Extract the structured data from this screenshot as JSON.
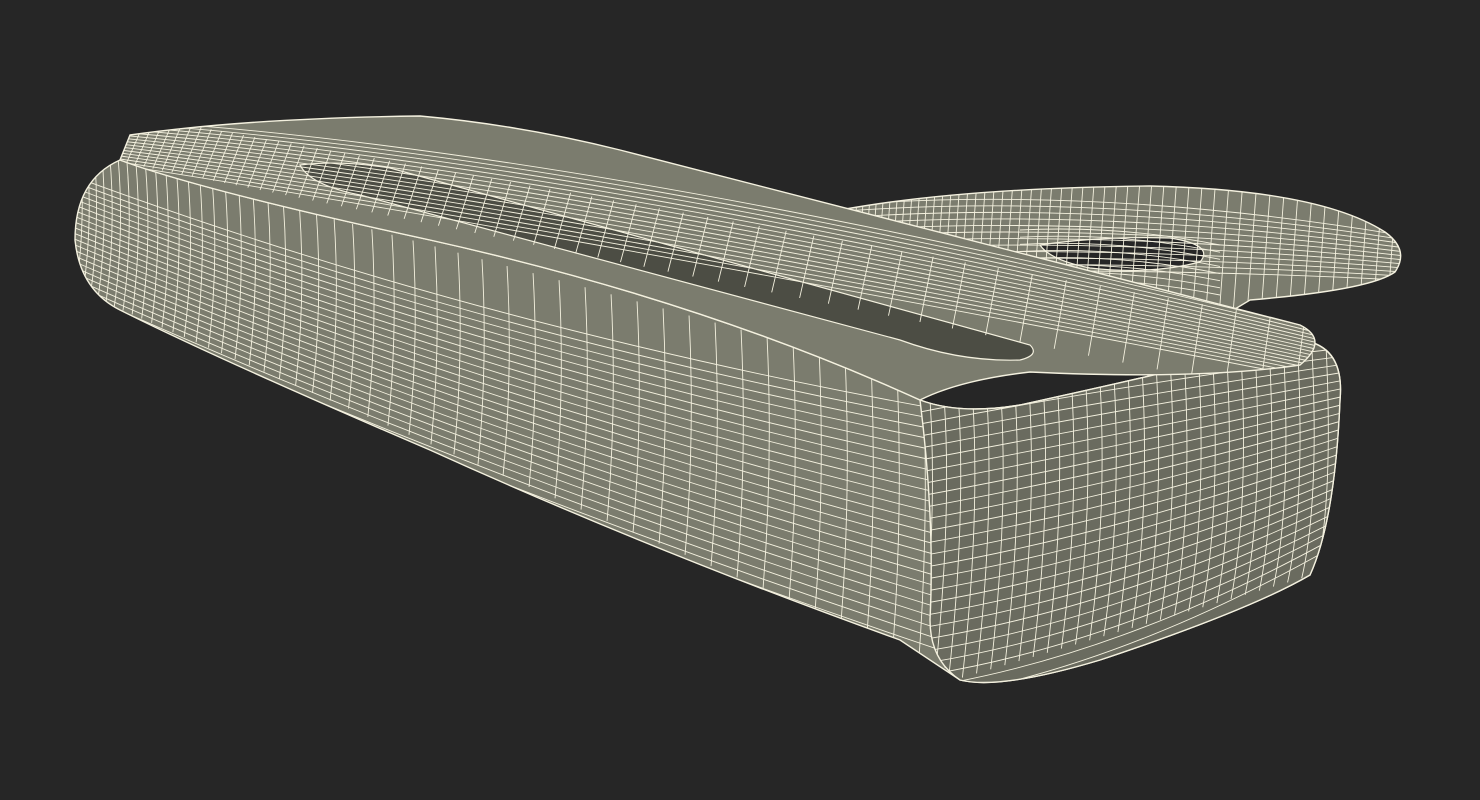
{
  "scene": {
    "subject": "wireframe-3d-model",
    "background_color": "#262626",
    "mesh_fill_color": "#7b7c6e",
    "mesh_shade_color": "#6a6b5f",
    "mesh_dark_color": "#4c4d44",
    "wire_color": "#f4f1df",
    "hole_color": "#262626"
  }
}
